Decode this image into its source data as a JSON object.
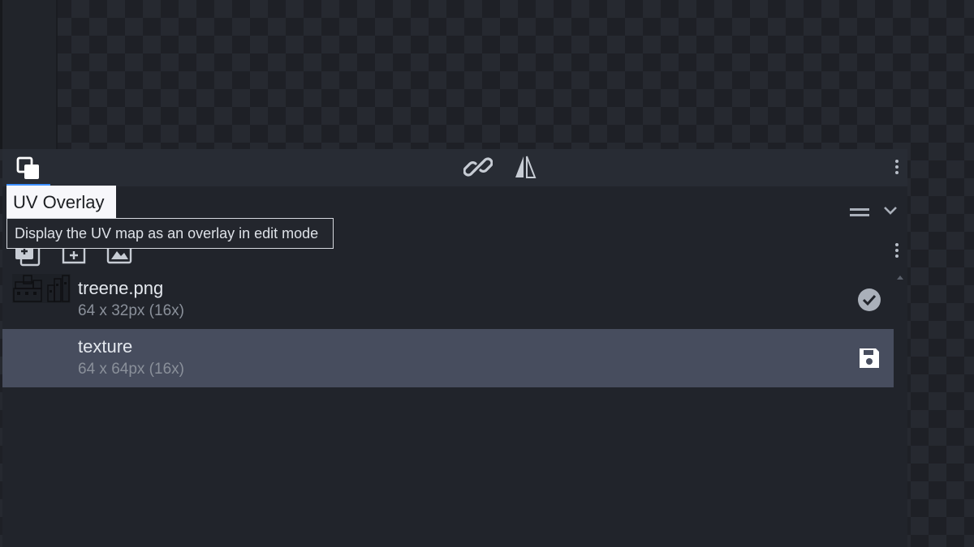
{
  "toolbar": {
    "uv_overlay_icon": "uv-overlay-icon",
    "link_icon": "link-icon",
    "mirror_icon": "mirror-icon",
    "menu_icon": "kebab-menu-icon"
  },
  "tooltip": {
    "title": "UV Overlay",
    "description": "Display the UV map as an overlay in edit mode"
  },
  "texture_panel": {
    "actions": [
      "add-texture-icon",
      "new-texture-icon",
      "import-image-icon"
    ],
    "textures": [
      {
        "name": "treene.png",
        "dims": "64 x 32px (16x)",
        "status_icon": "check-circle-icon",
        "selected": false
      },
      {
        "name": "texture",
        "dims": "64 x 64px (16x)",
        "status_icon": "save-icon",
        "selected": true
      }
    ]
  },
  "colors": {
    "accent": "#3e90ff",
    "panel_bg": "#21242b",
    "selected_row": "#474d5e"
  }
}
